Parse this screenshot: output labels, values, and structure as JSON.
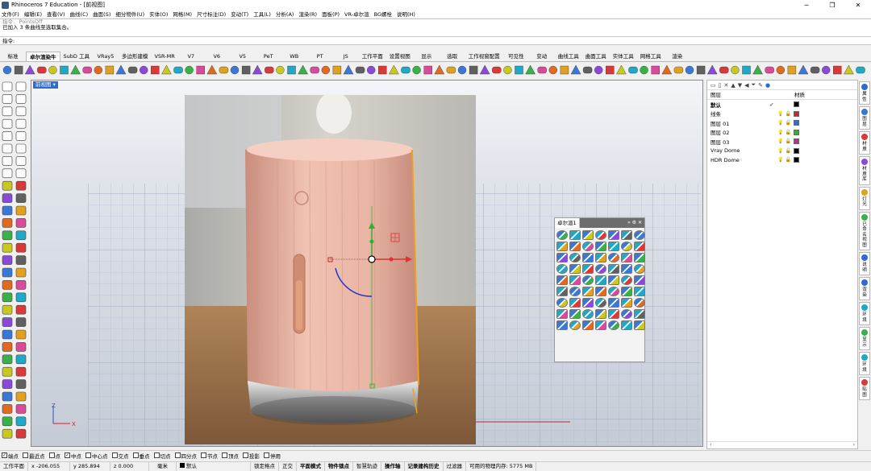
{
  "window": {
    "title": "Rhinoceros 7 Education - [前视图]",
    "controls": [
      "─",
      "❐",
      "✕"
    ]
  },
  "menu": [
    "文件(F)",
    "编辑(E)",
    "查看(V)",
    "曲线(C)",
    "曲面(S)",
    "细分物件(U)",
    "实体(O)",
    "网格(M)",
    "尺寸标注(D)",
    "变动(T)",
    "工具(L)",
    "分析(A)",
    "渲染(R)",
    "面板(P)",
    "VR-卓尔渲",
    "BG螺栓",
    "说明(H)"
  ],
  "command_history": {
    "prev": "指令: _PointsOff",
    "line": "已加入 3 条曲线至选取集合。"
  },
  "command_prompt": "指令:",
  "tabs": {
    "active_index": 1,
    "items": [
      "标准",
      "卓尔渲染牛",
      "SubD 工具",
      "VRay5",
      "多边形建模",
      "VSR-MR",
      "V7",
      "V6",
      "V5",
      "PeT",
      "WB",
      "PT",
      "JS",
      "工作平面",
      "设置视图",
      "显示",
      "选取",
      "工作视窗配置",
      "可见性",
      "变动",
      "曲线工具",
      "曲面工具",
      "实体工具",
      "网格工具",
      "渲染"
    ]
  },
  "viewport": {
    "label": "前视图",
    "axis_z": "Z",
    "axis_x": "X"
  },
  "float_panel": {
    "tab1": "卓尔渲1",
    "controls": "»  ⚙  ✕"
  },
  "layers_panel": {
    "header_name": "图层",
    "header_material": "材质",
    "rows": [
      {
        "name": "默认",
        "current": true,
        "color": "#000000"
      },
      {
        "name": "线条",
        "current": false,
        "color": "#e02020"
      },
      {
        "name": "图层 01",
        "current": false,
        "color": "#2e6fe0"
      },
      {
        "name": "图层 02",
        "current": false,
        "color": "#30b030"
      },
      {
        "name": "图层 03",
        "current": false,
        "color": "#d020a0"
      },
      {
        "name": "Vray Dome",
        "current": false,
        "color": "#000000"
      },
      {
        "name": "HDR Dome",
        "current": false,
        "color": "#000000"
      }
    ]
  },
  "side_tabs": [
    "属性",
    "图层",
    "材质",
    "材质库",
    "灯光",
    "已命名视图",
    "说明",
    "渲染",
    "环境",
    "显示",
    "环境",
    "贴图"
  ],
  "osnap": [
    {
      "label": "端点",
      "checked": true
    },
    {
      "label": "最近点",
      "checked": false
    },
    {
      "label": "点",
      "checked": false
    },
    {
      "label": "中点",
      "checked": true
    },
    {
      "label": "中心点",
      "checked": false
    },
    {
      "label": "交点",
      "checked": false
    },
    {
      "label": "垂点",
      "checked": false
    },
    {
      "label": "切点",
      "checked": false
    },
    {
      "label": "四分点",
      "checked": false
    },
    {
      "label": "节点",
      "checked": false
    },
    {
      "label": "顶点",
      "checked": false
    },
    {
      "label": "投影",
      "checked": false
    },
    {
      "label": "停用",
      "checked": false
    }
  ],
  "status": {
    "plane": "工作平面",
    "x": "x -206.055",
    "y": "y 285.894",
    "z": "z 0.000",
    "unit": "毫米",
    "layer": "默认",
    "items": [
      "锁定格点",
      "正交",
      "平面模式",
      "物件锁点",
      "智慧轨迹",
      "操作轴",
      "记录建构历史",
      "过滤器"
    ],
    "bold_items": [
      "平面模式",
      "物件锁点",
      "操作轴",
      "记录建构历史"
    ],
    "memory": "可用的物理内存: 5775 MB"
  },
  "colors": {
    "viewport_bg": "#c7ccd6",
    "active_label": "#2c6bd0",
    "product_pink": "#e9b7a6",
    "selection_orange": "#f0a020"
  }
}
